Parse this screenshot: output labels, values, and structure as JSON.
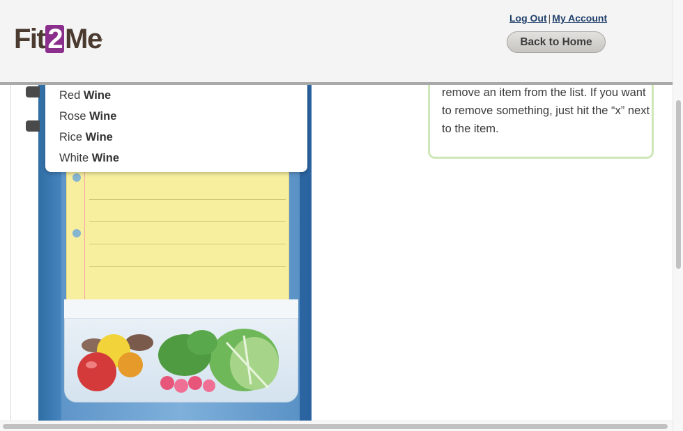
{
  "header": {
    "logo": {
      "part1": "Fit",
      "part2": "2",
      "part3": "Me",
      "mark": "."
    },
    "logout_label": "Log Out",
    "separator": "|",
    "account_label": "My Account",
    "home_button_label": "Back to Home"
  },
  "dropdown": {
    "items": [
      {
        "prefix": "Red ",
        "match": "Wine"
      },
      {
        "prefix": "Rose ",
        "match": "Wine"
      },
      {
        "prefix": "Rice ",
        "match": "Wine"
      },
      {
        "prefix": "White ",
        "match": "Wine"
      }
    ]
  },
  "tip": {
    "text": "remove an item from the list. If you want to remove something, just hit the “x” next to the item."
  },
  "colors": {
    "logo_brown": "#4a3a2f",
    "logo_purple": "#8a2f8b",
    "link_blue": "#1f3f6a",
    "fridge_blue": "#3a78b3",
    "notepad_yellow": "#f7ef9e",
    "tip_border_green": "#cde7b8"
  },
  "icons": [
    "fridge-handle-icon",
    "vegetables-illustration"
  ]
}
